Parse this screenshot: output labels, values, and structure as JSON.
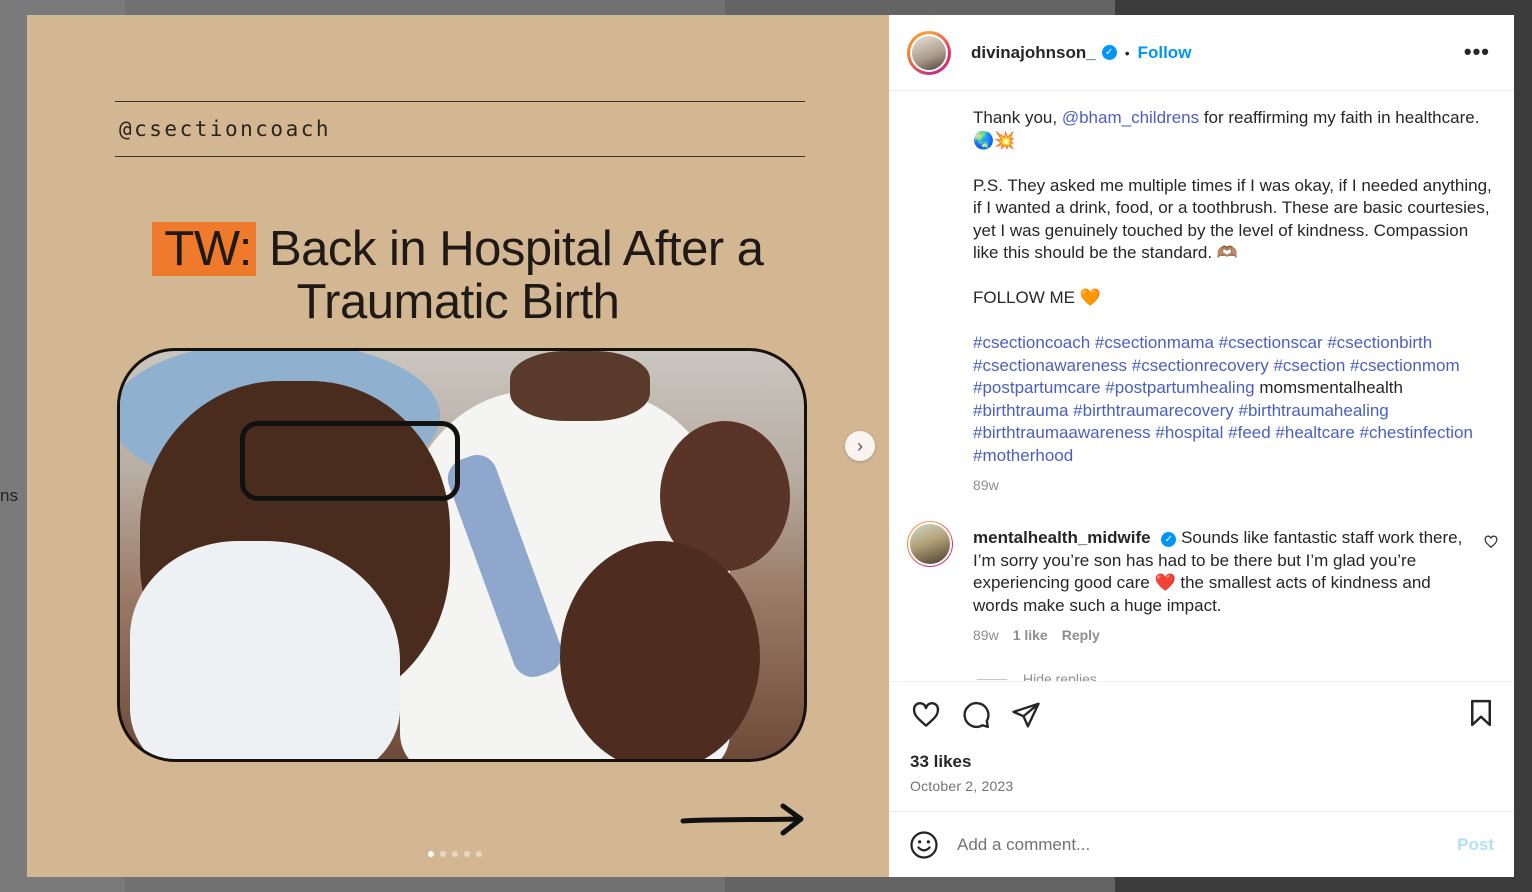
{
  "background": {
    "side_fragment": "ns"
  },
  "media": {
    "handle": "@csectioncoach",
    "tw_tag": "TW:",
    "headline_rest": "Back in Hospital After a",
    "headline_line2": "Traumatic Birth",
    "next_icon": "chevron-right",
    "dots_count": 5,
    "active_dot": 1
  },
  "post": {
    "username": "divinajohnson_",
    "follow_label": "Follow",
    "separator": "•",
    "more_label": "•••",
    "caption": {
      "line1_prefix": "Thank you, ",
      "mention": "@bham_childrens",
      "line1_suffix": " for reaffirming my faith in healthcare. 🌏💥",
      "ps": "P.S. They asked me multiple times if I was okay, if I needed anything, if I wanted a drink, food, or a toothbrush. These are basic courtesies, yet I was genuinely touched by the level of kindness. Compassion like this should be the standard. 🫶🏽",
      "follow_me": "FOLLOW ME 🧡",
      "tags_a": "#csectioncoach #csectionmama #csectionscar #csectionbirth #csectionawareness #csectionrecovery #csection #csectionmom #postpartumcare #postpartumhealing",
      "tag_plain": " momsmentalhealth ",
      "tags_b": "#birthtrauma #birthtraumarecovery #birthtraumahealing #birthtraumaawareness #hospital #feed #healtcare #chestinfection #motherhood"
    },
    "time": "89w",
    "comment": {
      "username": "mentalhealth_midwife",
      "text": "Sounds like fantastic staff work there, I’m sorry you’re son has had to be there but I’m glad you’re experiencing good care ❤️ the smallest acts of kindness and words make such a huge impact.",
      "time": "89w",
      "likes": "1 like",
      "reply": "Reply",
      "hide_replies": "Hide replies"
    },
    "likes": "33 likes",
    "date": "October 2, 2023",
    "add_comment_placeholder": "Add a comment...",
    "post_label": "Post"
  }
}
